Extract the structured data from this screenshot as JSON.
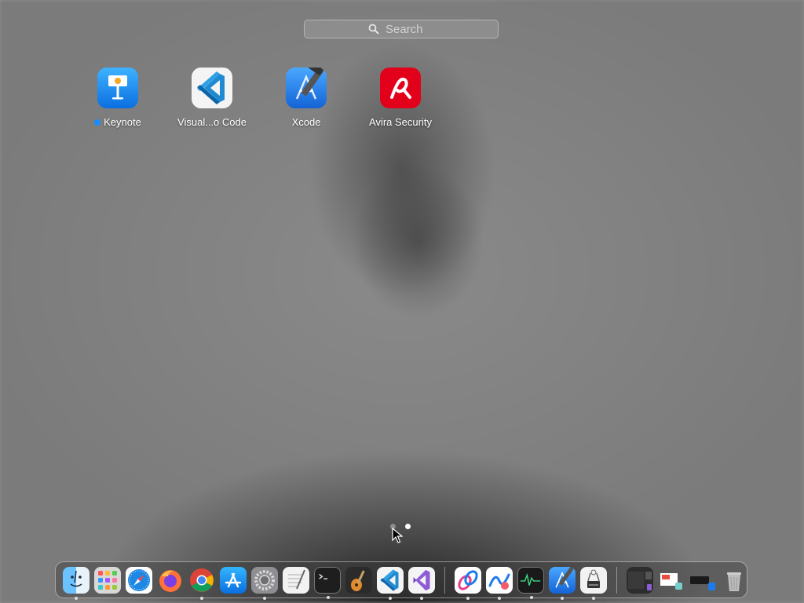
{
  "search": {
    "placeholder": "Search",
    "icon": "magnifier-icon"
  },
  "launchpad": {
    "apps": [
      {
        "name": "Keynote",
        "icon": "keynote-icon",
        "new": true
      },
      {
        "name": "Visual...o Code",
        "icon": "vscode-icon",
        "new": false
      },
      {
        "name": "Xcode",
        "icon": "xcode-icon",
        "new": false
      },
      {
        "name": "Avira Security",
        "icon": "avira-icon",
        "new": false
      }
    ],
    "page_count": 2,
    "current_page": 2
  },
  "dock": {
    "apps": [
      {
        "icon": "finder-icon",
        "running": true
      },
      {
        "icon": "launchpad-icon",
        "running": false
      },
      {
        "icon": "safari-icon",
        "running": false
      },
      {
        "icon": "firefox-icon",
        "running": false
      },
      {
        "icon": "chrome-icon",
        "running": true
      },
      {
        "icon": "app-store-icon",
        "running": false
      },
      {
        "icon": "system-settings-icon",
        "running": true
      },
      {
        "icon": "textedit-icon",
        "running": false
      },
      {
        "icon": "terminal-icon",
        "running": true
      },
      {
        "icon": "garageband-icon",
        "running": false
      },
      {
        "icon": "vscode-icon",
        "running": true
      },
      {
        "icon": "visual-studio-icon",
        "running": true
      }
    ],
    "recent": [
      {
        "icon": "link-app-icon",
        "running": true
      },
      {
        "icon": "freeform-icon",
        "running": true
      },
      {
        "icon": "activity-monitor-icon",
        "running": true
      },
      {
        "icon": "xcode-icon",
        "running": true
      },
      {
        "icon": "system-information-icon",
        "running": true
      }
    ],
    "folders": [
      {
        "icon": "window-thumbnail-icon"
      },
      {
        "icon": "presentation-thumbnail-icon"
      },
      {
        "icon": "downloads-folder-icon"
      },
      {
        "icon": "trash-icon"
      }
    ]
  },
  "colors": {
    "accent": "#1a8cff",
    "avira_red": "#e3001b",
    "xcode_blue": "#1c7ced"
  }
}
